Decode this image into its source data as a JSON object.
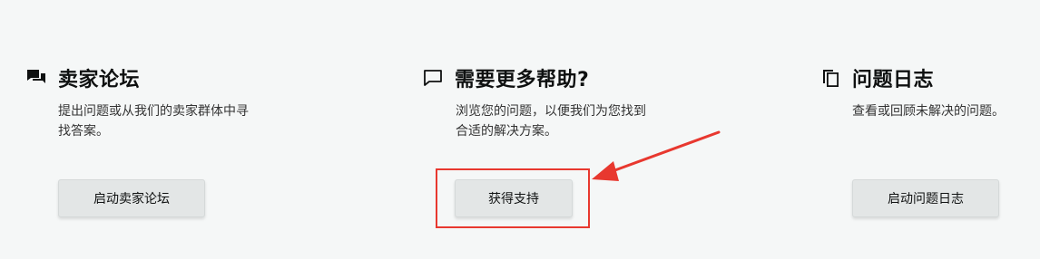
{
  "colors": {
    "background": "#f5f7f7",
    "text_primary": "#0f1111",
    "button_bg": "#e3e6e6",
    "annotation_red": "#e8382f"
  },
  "cards": {
    "forum": {
      "icon": "chat-bubbles-icon",
      "title": "卖家论坛",
      "description": "提出问题或从我们的卖家群体中寻\n找答案。",
      "button_label": "启动卖家论坛"
    },
    "help": {
      "icon": "chat-bubble-outline-icon",
      "title": "需要更多帮助?",
      "description": "浏览您的问题，以便我们为您找到\n合适的解决方案。",
      "button_label": "获得支持"
    },
    "log": {
      "icon": "copy-pages-icon",
      "title": "问题日志",
      "description": "查看或回顾未解决的问题。",
      "button_label": "启动问题日志"
    }
  },
  "annotation": {
    "highlight": "highlight-box",
    "arrow": "arrow-icon"
  }
}
